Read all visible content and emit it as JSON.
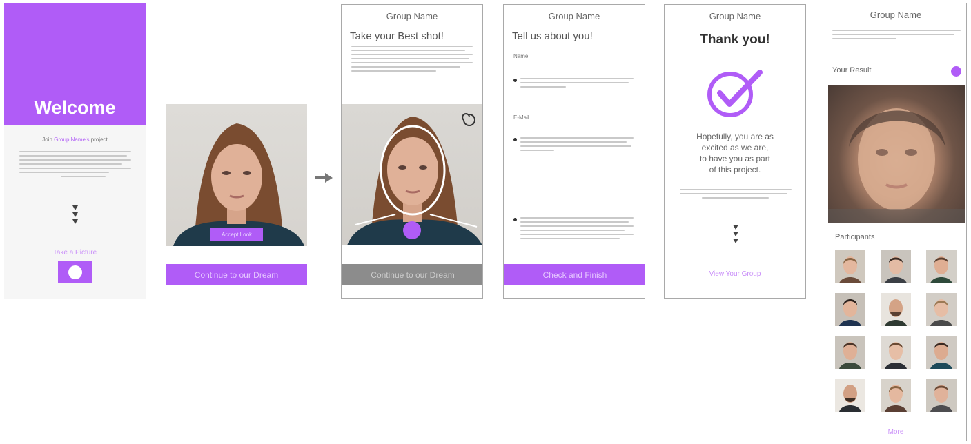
{
  "screen1": {
    "title": "Welcome",
    "join_prefix": "Join ",
    "join_group": "Group Name's",
    "join_suffix": " project",
    "cta": "Take a Picture"
  },
  "screen2": {
    "overlay_label": "Accept Look",
    "button": "Continue to our Dream"
  },
  "group_name": "Group Name",
  "screen3": {
    "heading": "Take your Best shot!",
    "button": "Continue to our Dream"
  },
  "screen4": {
    "heading": "Tell us about you!",
    "field1_label": "Name",
    "field2_label": "E-Mail",
    "button": "Check and Finish"
  },
  "screen5": {
    "heading": "Thank you!",
    "message_line1": "Hopefully, you are as",
    "message_line2": "excited as we are,",
    "message_line3": "to have you as part",
    "message_line4": "of this project.",
    "link": "View Your Group"
  },
  "screen6": {
    "result_label": "Your Result",
    "participants_label": "Participants",
    "more": "More"
  },
  "colors": {
    "accent": "#b05cf7",
    "grey_button": "#8c8c8c"
  }
}
